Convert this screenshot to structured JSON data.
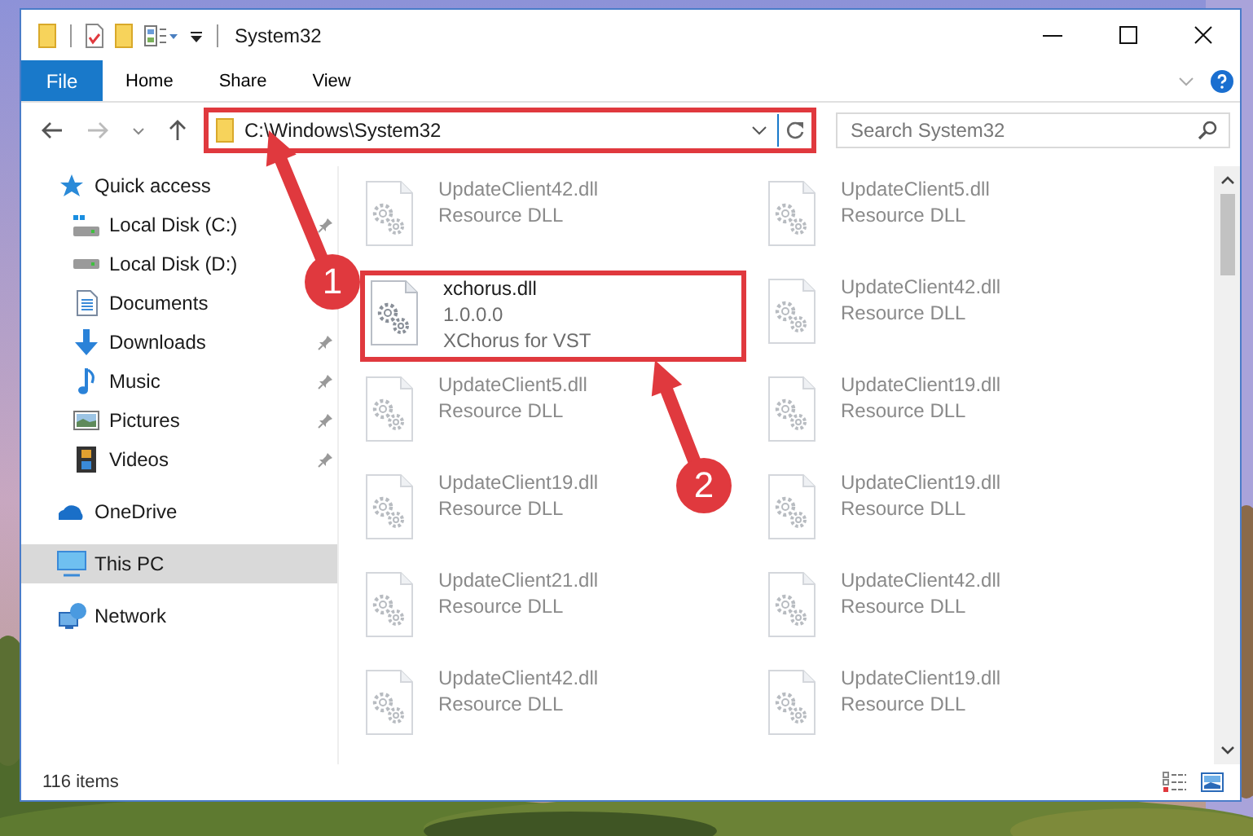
{
  "window": {
    "title": "System32"
  },
  "ribbon": {
    "file_button": "File",
    "tabs": [
      "Home",
      "Share",
      "View"
    ]
  },
  "address_bar": {
    "path": "C:\\Windows\\System32",
    "highlighted": true
  },
  "search": {
    "placeholder": "Search System32"
  },
  "nav": [
    {
      "label": "Quick access",
      "kind": "star",
      "pinned": false,
      "selected": false,
      "children": [
        {
          "label": "Local Disk (C:)",
          "kind": "drive-c",
          "pinned": true,
          "selected": false
        },
        {
          "label": "Local Disk (D:)",
          "kind": "drive",
          "pinned": false,
          "selected": false
        },
        {
          "label": "Documents",
          "kind": "documents",
          "pinned": false,
          "selected": false
        },
        {
          "label": "Downloads",
          "kind": "downloads",
          "pinned": true,
          "selected": false
        },
        {
          "label": "Music",
          "kind": "music",
          "pinned": true,
          "selected": false
        },
        {
          "label": "Pictures",
          "kind": "pictures",
          "pinned": true,
          "selected": false
        },
        {
          "label": "Videos",
          "kind": "videos",
          "pinned": true,
          "selected": false
        }
      ]
    },
    {
      "label": "OneDrive",
      "kind": "cloud",
      "pinned": false,
      "selected": false
    },
    {
      "label": "This PC",
      "kind": "pc",
      "pinned": false,
      "selected": true
    },
    {
      "label": "Network",
      "kind": "network",
      "pinned": false,
      "selected": false
    }
  ],
  "files": [
    {
      "name": "UpdateClient42.dll",
      "details": [
        "Resource DLL"
      ],
      "blurred": true,
      "highlighted": false
    },
    {
      "name": "UpdateClient5.dll",
      "details": [
        "Resource DLL"
      ],
      "blurred": true,
      "highlighted": false
    },
    {
      "name": "xchorus.dll",
      "details": [
        "1.0.0.0",
        "XChorus for VST"
      ],
      "blurred": false,
      "highlighted": true
    },
    {
      "name": "UpdateClient42.dll",
      "details": [
        "Resource DLL"
      ],
      "blurred": true,
      "highlighted": false
    },
    {
      "name": "UpdateClient5.dll",
      "details": [
        "Resource DLL"
      ],
      "blurred": true,
      "highlighted": false
    },
    {
      "name": "UpdateClient19.dll",
      "details": [
        "Resource DLL"
      ],
      "blurred": true,
      "highlighted": false
    },
    {
      "name": "UpdateClient19.dll",
      "details": [
        "Resource DLL"
      ],
      "blurred": true,
      "highlighted": false
    },
    {
      "name": "UpdateClient19.dll",
      "details": [
        "Resource DLL"
      ],
      "blurred": true,
      "highlighted": false
    },
    {
      "name": "UpdateClient21.dll",
      "details": [
        "Resource DLL"
      ],
      "blurred": true,
      "highlighted": false
    },
    {
      "name": "UpdateClient42.dll",
      "details": [
        "Resource DLL"
      ],
      "blurred": true,
      "highlighted": false
    },
    {
      "name": "UpdateClient42.dll",
      "details": [
        "Resource DLL"
      ],
      "blurred": true,
      "highlighted": false
    },
    {
      "name": "UpdateClient19.dll",
      "details": [
        "Resource DLL"
      ],
      "blurred": true,
      "highlighted": false
    }
  ],
  "status_bar": {
    "item_count": "116 items"
  },
  "annotations": [
    {
      "label": "1"
    },
    {
      "label": "2"
    }
  ]
}
